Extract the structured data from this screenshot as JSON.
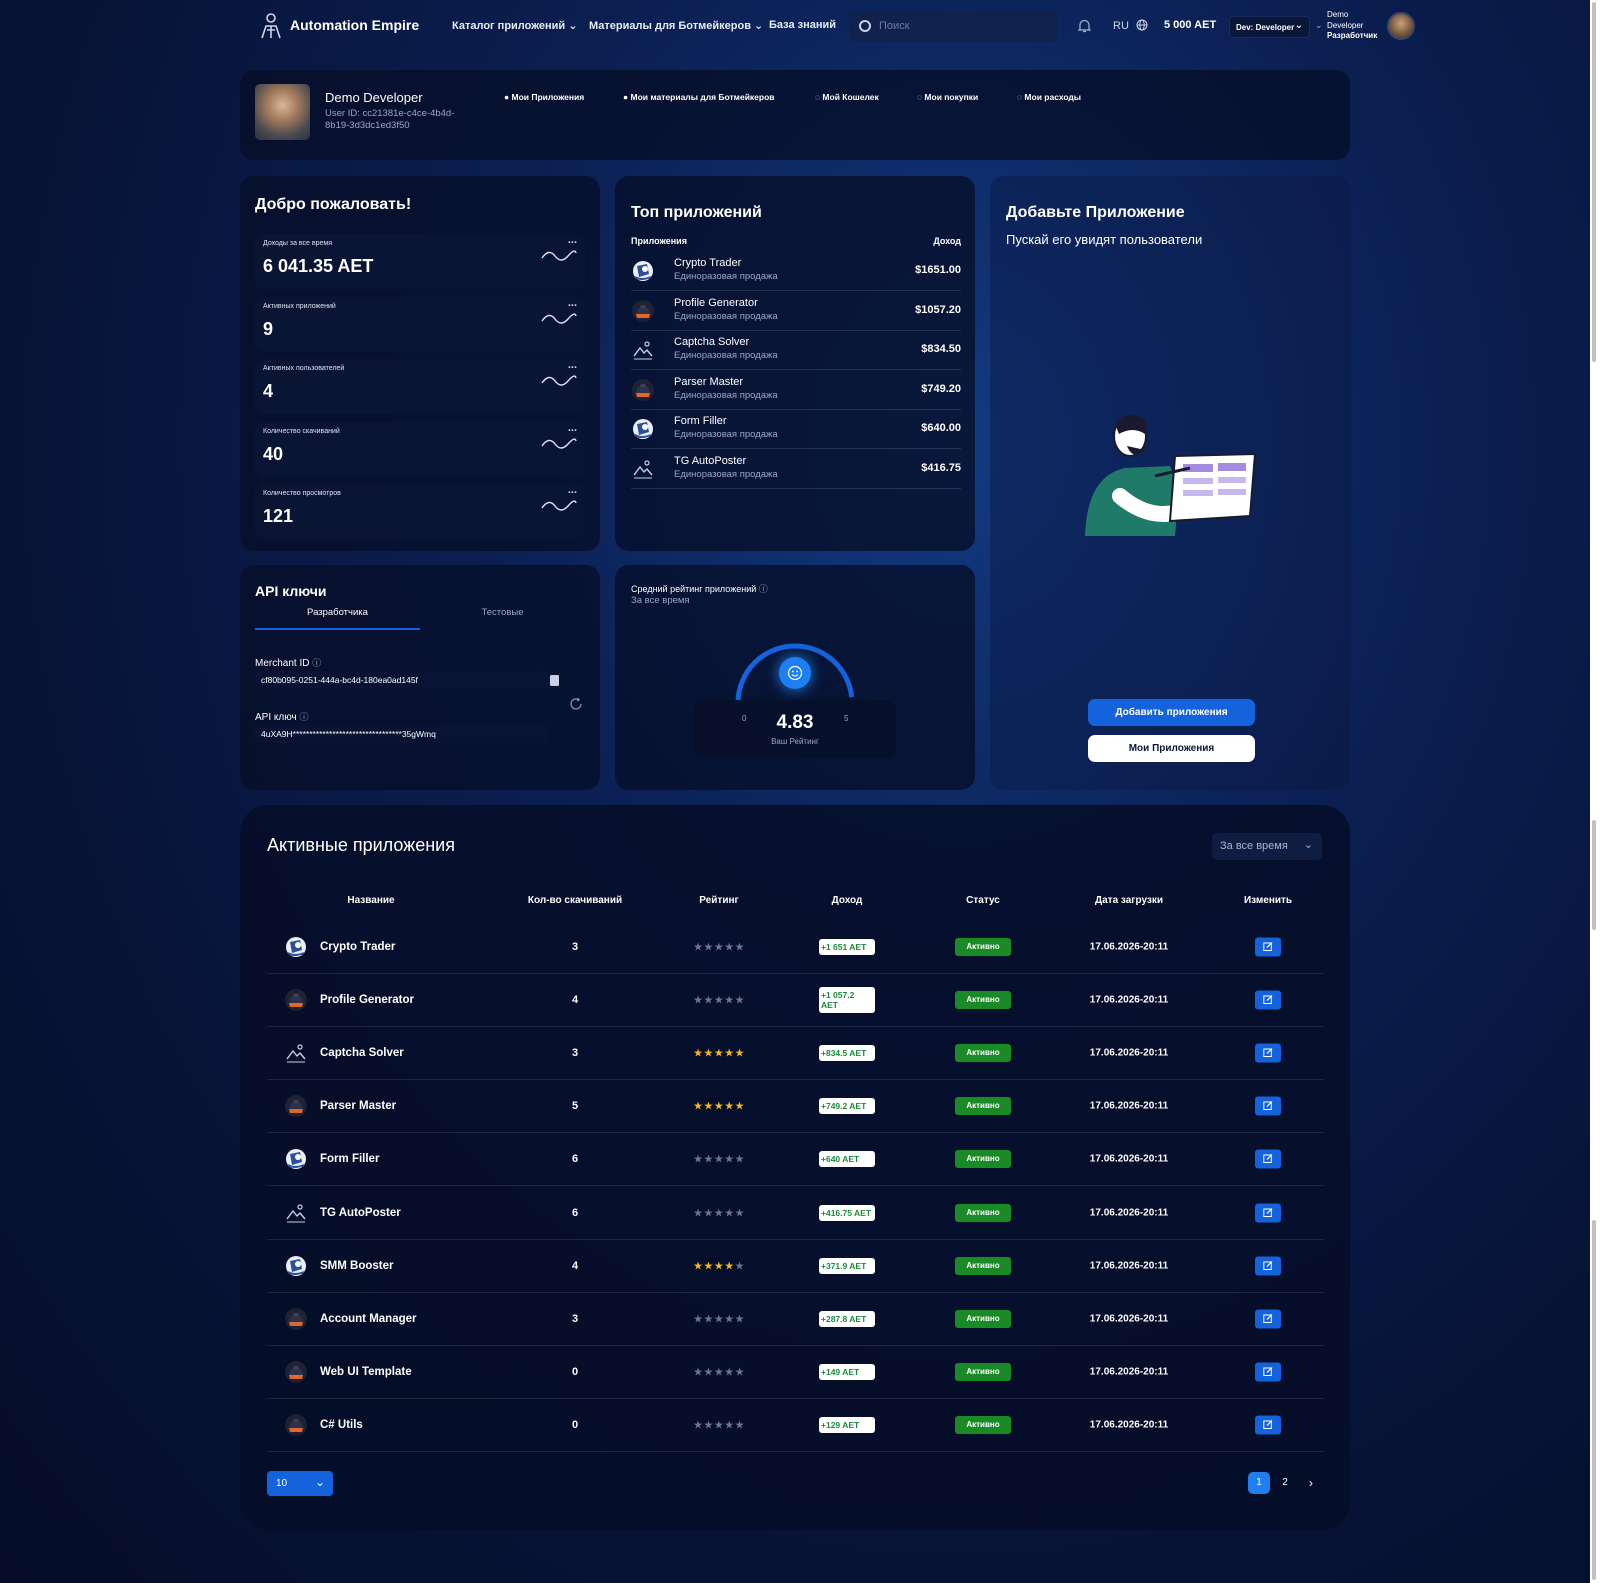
{
  "header": {
    "brand": "Automation Empire",
    "nav": [
      "Каталог приложений",
      "Материалы для Ботмейкеров",
      "База знаний"
    ],
    "search_placeholder": "Поиск",
    "lang": "RU",
    "balance": "5 000 AET",
    "dev_select": "Dev: Developer",
    "user_line1": "Demo",
    "user_line2": "Developer",
    "user_role": "Разработчик"
  },
  "profile": {
    "name": "Demo Developer",
    "user_id_line1": "User ID: cc21381e-c4ce-4b4d-",
    "user_id_line2": "8b19-3d3dc1ed3f50",
    "tabs": [
      "Мои Приложения",
      "Мои материалы для Ботмейкеров",
      "Мой Кошелек",
      "Мои покупки",
      "Мои расходы"
    ]
  },
  "welcome": {
    "title": "Добро пожаловать!",
    "stats": [
      {
        "label": "Доходы за все время",
        "value": "6 041.35 AET"
      },
      {
        "label": "Активных приложений",
        "value": "9"
      },
      {
        "label": "Активных пользователей",
        "value": "4"
      },
      {
        "label": "Количество скачиваний",
        "value": "40"
      },
      {
        "label": "Количество просмотров",
        "value": "121"
      }
    ],
    "dots": "..."
  },
  "top_apps": {
    "title": "Топ приложений",
    "col_apps": "Приложения",
    "col_income": "Доход",
    "items": [
      {
        "name": "Crypto Trader",
        "sub": "Единоразовая продажа",
        "income": "$1651.00",
        "icon": "robot-icon"
      },
      {
        "name": "Profile Generator",
        "sub": "Единоразовая продажа",
        "income": "$1057.20",
        "icon": "piano-icon"
      },
      {
        "name": "Captcha Solver",
        "sub": "Единоразовая продажа",
        "income": "$834.50",
        "icon": "image-icon"
      },
      {
        "name": "Parser Master",
        "sub": "Единоразовая продажа",
        "income": "$749.20",
        "icon": "piano-icon"
      },
      {
        "name": "Form Filler",
        "sub": "Единоразовая продажа",
        "income": "$640.00",
        "icon": "robot-icon"
      },
      {
        "name": "TG AutoPoster",
        "sub": "Единоразовая продажа",
        "income": "$416.75",
        "icon": "image-icon"
      }
    ]
  },
  "add_app": {
    "title": "Добавьте Приложение",
    "subtitle": "Пускай его увидят пользователи",
    "primary_btn": "Добавить приложения",
    "secondary_btn": "Мои Приложения"
  },
  "api": {
    "title": "API ключи",
    "tab_dev": "Разработчика",
    "tab_test": "Тестовые",
    "merchant_label": "Merchant ID",
    "merchant_value": "cf80b095-0251-444a-bc4d-180ea0ad145f",
    "key_label": "API ключ",
    "key_value": "4uXA9H*********************************35gWmq"
  },
  "rating": {
    "label": "Средний рейтинг приложений",
    "period": "За все время",
    "value": "4.83",
    "min": "0",
    "max": "5",
    "caption": "Ваш Рейтинг",
    "fraction": 0.966
  },
  "active_apps": {
    "title": "Активные приложения",
    "period": "За все время",
    "columns": [
      "Название",
      "Кол-во скачиваний",
      "Рейтинг",
      "Доход",
      "Статус",
      "Дата загрузки",
      "Изменить"
    ],
    "rows": [
      {
        "name": "Crypto Trader",
        "downloads": "3",
        "stars": 0,
        "income": "+1 651 AET",
        "status": "Активно",
        "date": "17.06.2026-20:11",
        "icon": "robot-icon"
      },
      {
        "name": "Profile Generator",
        "downloads": "4",
        "stars": 0,
        "income": "+1 057.2 AET",
        "status": "Активно",
        "date": "17.06.2026-20:11",
        "icon": "piano-icon"
      },
      {
        "name": "Captcha Solver",
        "downloads": "3",
        "stars": 5,
        "income": "+834.5 AET",
        "status": "Активно",
        "date": "17.06.2026-20:11",
        "icon": "image-icon"
      },
      {
        "name": "Parser Master",
        "downloads": "5",
        "stars": 5,
        "income": "+749.2 AET",
        "status": "Активно",
        "date": "17.06.2026-20:11",
        "icon": "piano-icon"
      },
      {
        "name": "Form Filler",
        "downloads": "6",
        "stars": 0,
        "income": "+640 AET",
        "status": "Активно",
        "date": "17.06.2026-20:11",
        "icon": "robot-icon"
      },
      {
        "name": "TG AutoPoster",
        "downloads": "6",
        "stars": 0,
        "income": "+416.75 AET",
        "status": "Активно",
        "date": "17.06.2026-20:11",
        "icon": "image-icon"
      },
      {
        "name": "SMM Booster",
        "downloads": "4",
        "stars": 4,
        "income": "+371.9 AET",
        "status": "Активно",
        "date": "17.06.2026-20:11",
        "icon": "robot-icon"
      },
      {
        "name": "Account Manager",
        "downloads": "3",
        "stars": 0,
        "income": "+287.8 AET",
        "status": "Активно",
        "date": "17.06.2026-20:11",
        "icon": "piano-icon"
      },
      {
        "name": "Web UI Template",
        "downloads": "0",
        "stars": 0,
        "income": "+149 AET",
        "status": "Активно",
        "date": "17.06.2026-20:11",
        "icon": "piano-icon"
      },
      {
        "name": "C# Utils",
        "downloads": "0",
        "stars": 0,
        "income": "+129 AET",
        "status": "Активно",
        "date": "17.06.2026-20:11",
        "icon": "piano-icon"
      }
    ],
    "page_size": "10",
    "pages": [
      "1",
      "2"
    ],
    "current_page": "1"
  },
  "colors": {
    "accent": "#1462dc",
    "status_green": "#1a8a26",
    "income_green": "#1c8a3c",
    "star_gold": "#f5b81c"
  }
}
